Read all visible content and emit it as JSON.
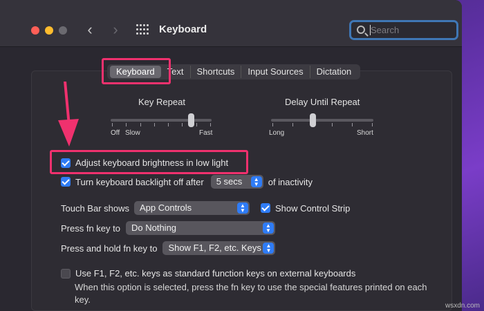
{
  "window": {
    "title": "Keyboard"
  },
  "search": {
    "placeholder": "Search"
  },
  "tabs": [
    {
      "label": "Keyboard",
      "active": true
    },
    {
      "label": "Text"
    },
    {
      "label": "Shortcuts"
    },
    {
      "label": "Input Sources"
    },
    {
      "label": "Dictation"
    }
  ],
  "key_repeat": {
    "label": "Key Repeat",
    "left_label": "Off",
    "left_label2": "Slow",
    "right_label": "Fast",
    "value_fraction": 0.8
  },
  "delay_until_repeat": {
    "label": "Delay Until Repeat",
    "left_label": "Long",
    "right_label": "Short",
    "value_fraction": 0.4
  },
  "adjust_brightness": {
    "label": "Adjust keyboard brightness in low light",
    "checked": true
  },
  "backlight_off": {
    "label_before": "Turn keyboard backlight off after",
    "value": "5 secs",
    "label_after": "of inactivity",
    "checked": true
  },
  "touch_bar": {
    "label": "Touch Bar shows",
    "value": "App Controls",
    "strip_label": "Show Control Strip",
    "strip_checked": true
  },
  "fn_key": {
    "label": "Press fn key to",
    "value": "Do Nothing"
  },
  "hold_fn_key": {
    "label": "Press and hold fn key to",
    "value": "Show F1, F2, etc. Keys"
  },
  "function_keys": {
    "label": "Use F1, F2, etc. keys as standard function keys on external keyboards",
    "checked": false,
    "note": "When this option is selected, press the fn key to use the special features printed on each key."
  },
  "watermark": "wsxdn.com",
  "colors": {
    "highlight": "#f0316e",
    "accent": "#2f7cf6"
  }
}
